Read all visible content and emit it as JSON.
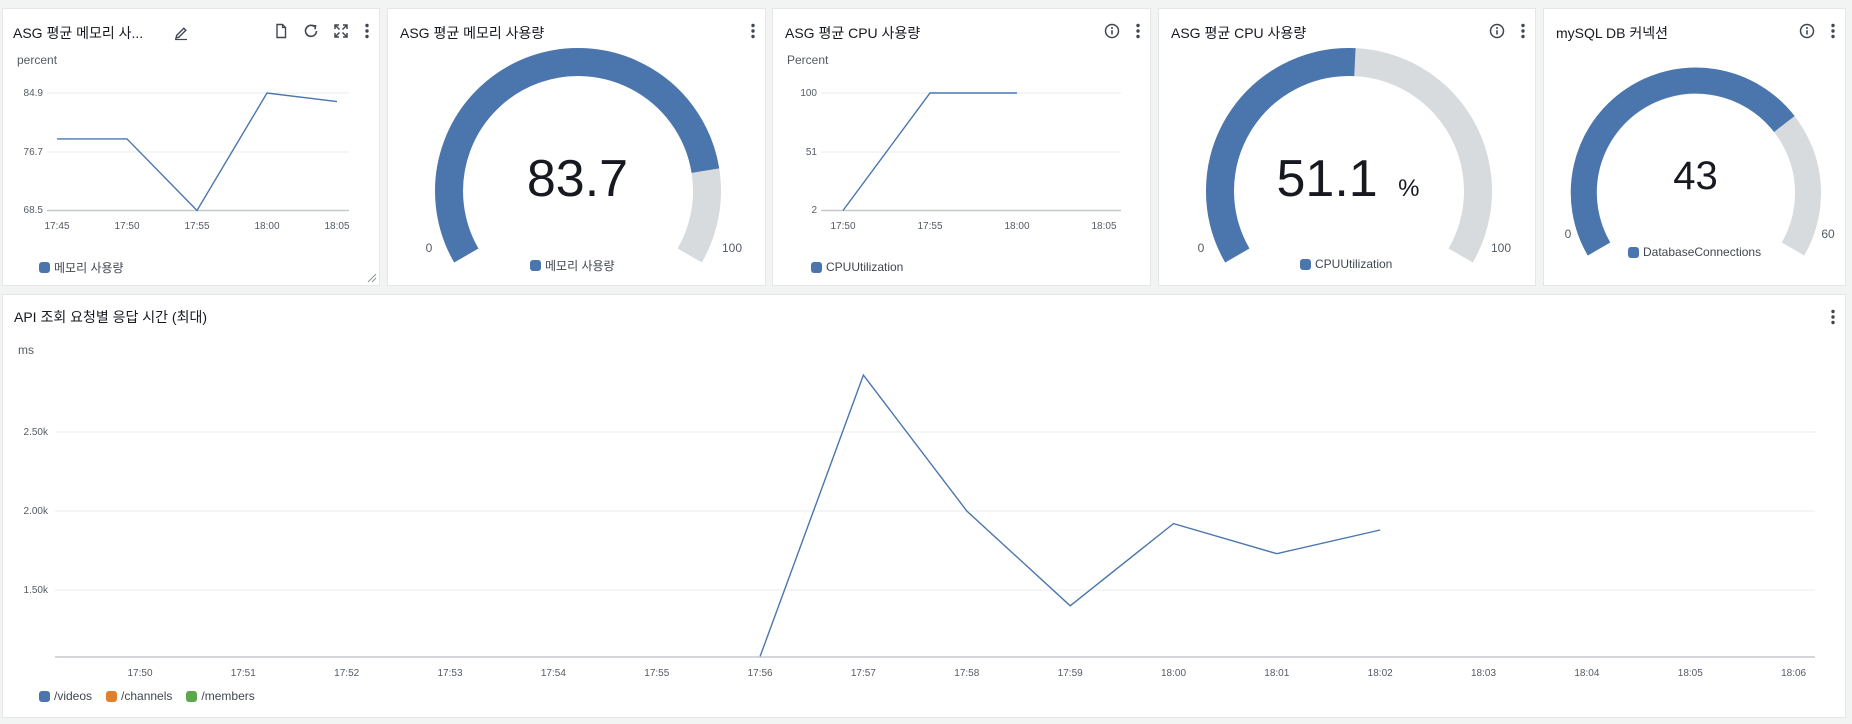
{
  "colors": {
    "series_blue": "#4a76ad",
    "series_orange": "#e07f2e",
    "series_green": "#5aa84a",
    "gauge_track": "#d8dbdd"
  },
  "widgets": {
    "mem_line": {
      "title": "ASG 평균 메모리 사...",
      "unit": "percent",
      "y_ticks": [
        "84.9",
        "76.7",
        "68.5"
      ],
      "x_ticks": [
        "17:45",
        "17:50",
        "17:55",
        "18:00",
        "18:05"
      ],
      "legend": [
        "메모리 사용량"
      ],
      "chart_data": {
        "type": "line",
        "x": [
          "17:45",
          "17:50",
          "17:55",
          "18:00",
          "18:05"
        ],
        "series": [
          {
            "name": "메모리 사용량",
            "values": [
              78.5,
              78.5,
              68.5,
              84.9,
              83.7
            ]
          }
        ],
        "ylim": [
          68.5,
          84.9
        ],
        "ylabel": "percent"
      }
    },
    "mem_gauge": {
      "title": "ASG 평균 메모리 사용량",
      "value_text": "83.7",
      "min_label": "0",
      "max_label": "100",
      "legend": [
        "메모리 사용량"
      ],
      "chart_data": {
        "type": "gauge",
        "value": 83.7,
        "min": 0,
        "max": 100
      }
    },
    "cpu_line": {
      "title": "ASG 평균 CPU 사용량",
      "unit": "Percent",
      "y_ticks": [
        "100",
        "51",
        "2"
      ],
      "x_ticks": [
        "17:50",
        "17:55",
        "18:00",
        "18:05"
      ],
      "legend": [
        "CPUUtilization"
      ],
      "chart_data": {
        "type": "line",
        "x": [
          "17:50",
          "17:55",
          "18:00"
        ],
        "series": [
          {
            "name": "CPUUtilization",
            "values": [
              2,
              100,
              100
            ]
          }
        ],
        "ylim": [
          2,
          100
        ],
        "ylabel": "Percent"
      }
    },
    "cpu_gauge": {
      "title": "ASG 평균 CPU 사용량",
      "value_text": "51.1",
      "value_unit": "%",
      "min_label": "0",
      "max_label": "100",
      "legend": [
        "CPUUtilization"
      ],
      "chart_data": {
        "type": "gauge",
        "value": 51.1,
        "min": 0,
        "max": 100
      }
    },
    "db_gauge": {
      "title": "mySQL DB 커넥션",
      "value_text": "43",
      "min_label": "0",
      "max_label": "60",
      "legend": [
        "DatabaseConnections"
      ],
      "chart_data": {
        "type": "gauge",
        "value": 43,
        "min": 0,
        "max": 60
      }
    },
    "api_line": {
      "title": "API 조회 요청별 응답 시간 (최대)",
      "unit": "ms",
      "y_ticks": [
        "2.50k",
        "2.00k",
        "1.50k"
      ],
      "x_ticks": [
        "17:50",
        "17:51",
        "17:52",
        "17:53",
        "17:54",
        "17:55",
        "17:56",
        "17:57",
        "17:58",
        "17:59",
        "18:00",
        "18:01",
        "18:02",
        "18:03",
        "18:04",
        "18:05",
        "18:06"
      ],
      "legend": [
        "/videos",
        "/channels",
        "/members"
      ],
      "chart_data": {
        "type": "line",
        "x": [
          "17:56",
          "17:57",
          "17:58",
          "17:59",
          "18:00",
          "18:01",
          "18:02"
        ],
        "series": [
          {
            "name": "/videos",
            "values": [
              1080,
              2860,
              2000,
              1400,
              1920,
              1730,
              1880
            ]
          },
          {
            "name": "/channels",
            "values": []
          },
          {
            "name": "/members",
            "values": []
          }
        ],
        "ylim": [
          1080,
          3000
        ],
        "ylabel": "ms"
      }
    }
  }
}
